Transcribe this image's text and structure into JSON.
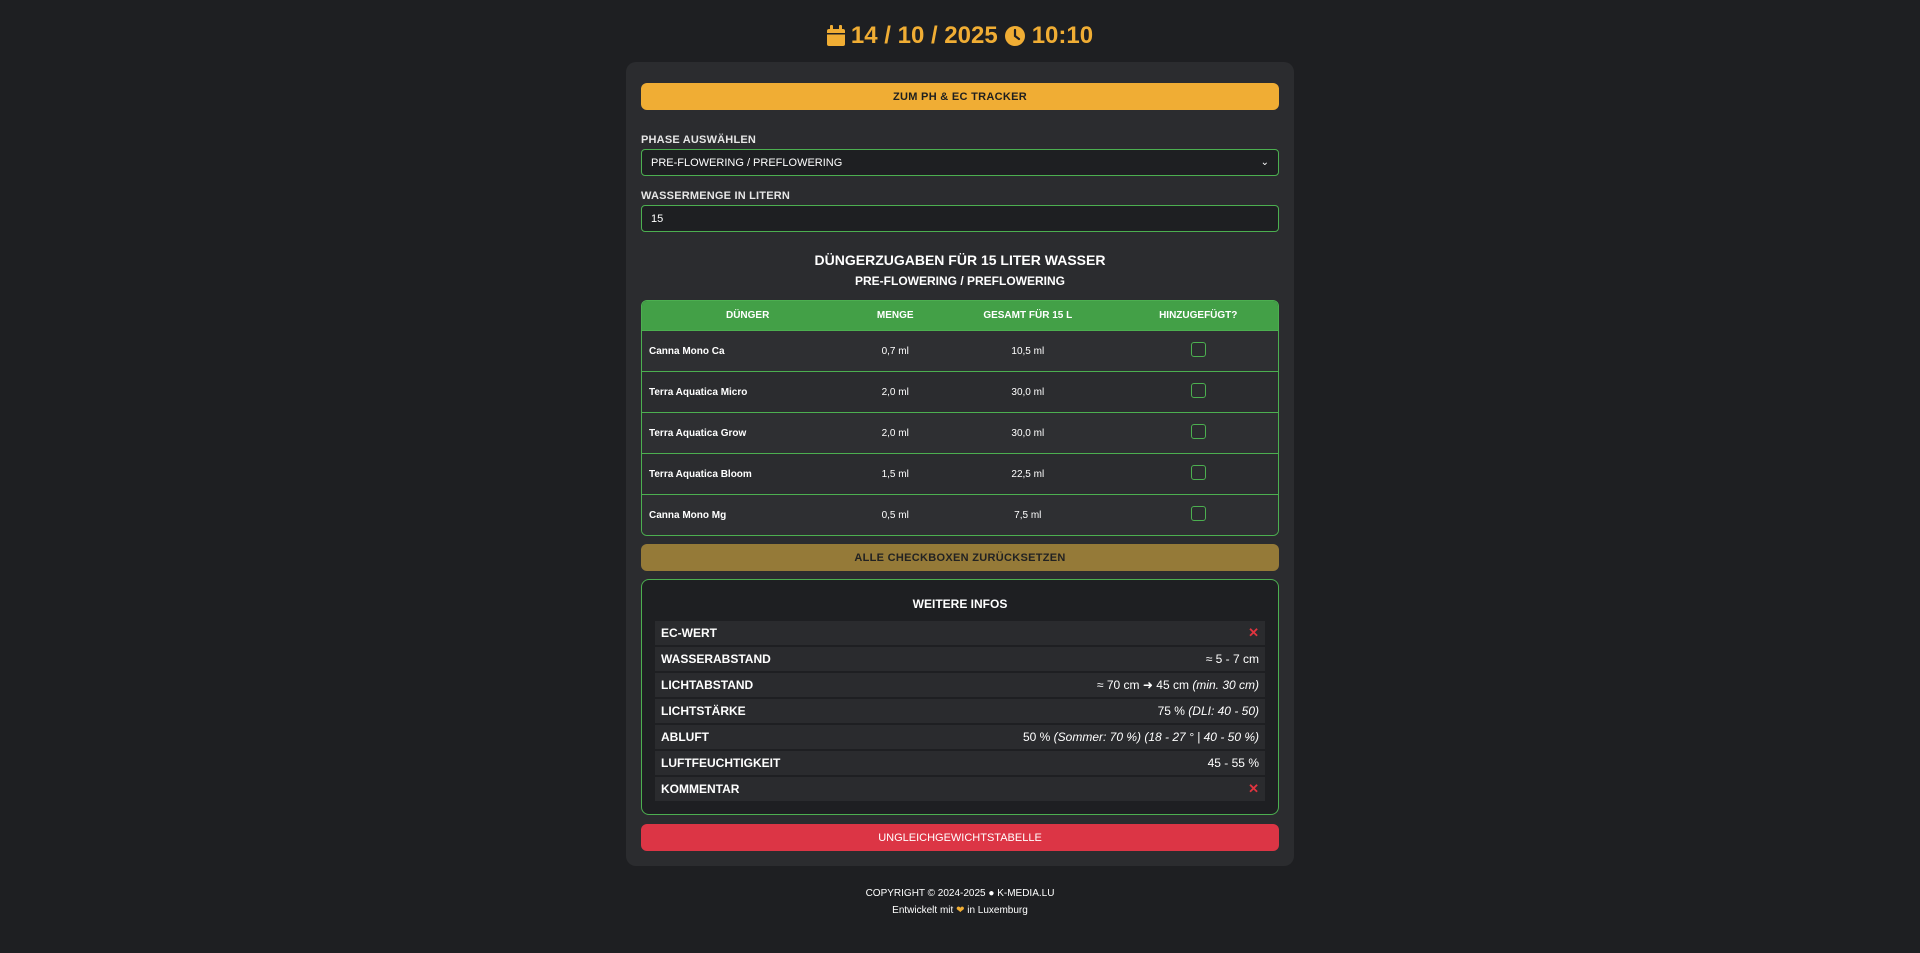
{
  "header": {
    "date": "14 / 10 / 2025",
    "time": "10:10",
    "date_icon": "calendar-icon",
    "time_icon": "clock-icon"
  },
  "tracker_button": "ZUM PH & EC TRACKER",
  "phase": {
    "label": "PHASE AUSWÄHLEN",
    "selected": "PRE-FLOWERING / PREFLOWERING"
  },
  "water": {
    "label": "WASSERMENGE IN LITERN",
    "value": "15"
  },
  "section": {
    "title": "DÜNGERZUGABEN FÜR 15 LITER WASSER",
    "subtitle": "PRE-FLOWERING / PREFLOWERING"
  },
  "table": {
    "headers": [
      "DÜNGER",
      "MENGE",
      "GESAMT FÜR 15 L",
      "HINZUGEFÜGT?"
    ],
    "rows": [
      {
        "name": "Canna Mono Ca",
        "amount": "0,7 ml",
        "total": "10,5 ml",
        "added": false
      },
      {
        "name": "Terra Aquatica Micro",
        "amount": "2,0 ml",
        "total": "30,0 ml",
        "added": false
      },
      {
        "name": "Terra Aquatica Grow",
        "amount": "2,0 ml",
        "total": "30,0 ml",
        "added": false
      },
      {
        "name": "Terra Aquatica Bloom",
        "amount": "1,5 ml",
        "total": "22,5 ml",
        "added": false
      },
      {
        "name": "Canna Mono Mg",
        "amount": "0,5 ml",
        "total": "7,5 ml",
        "added": false
      }
    ]
  },
  "reset_button": "ALLE CHECKBOXEN ZURÜCKSETZEN",
  "info": {
    "title": "WEITERE INFOS",
    "rows": [
      {
        "key": "EC-WERT",
        "value": "✕"
      },
      {
        "key": "WASSERABSTAND",
        "value": "≈ 5 - 7 cm"
      },
      {
        "key": "LICHTABSTAND",
        "value_a": "≈ 70 cm",
        "value_b": "45 cm",
        "note": "(min. 30 cm)"
      },
      {
        "key": "LICHTSTÄRKE",
        "value": "75 %",
        "note": "(DLI: 40 - 50)"
      },
      {
        "key": "ABLUFT",
        "value": "50 %",
        "note": "(Sommer: 70 %) (18 - 27 ° | 40 - 50 %)"
      },
      {
        "key": "LUFTFEUCHTIGKEIT",
        "value": "45 - 55 %"
      },
      {
        "key": "KOMMENTAR",
        "value": "✕"
      }
    ]
  },
  "imbalance_button": "UNGLEICHGEWICHTSTABELLE",
  "footer": {
    "copyright": "COPYRIGHT © 2024-2025 ● K-MEDIA.LU",
    "made_prefix": "Entwickelt mit",
    "made_suffix": "in Luxemburg",
    "heart_color": "#f0ad34"
  },
  "colors": {
    "accent": "#f0ad34",
    "green": "#4caf50",
    "danger": "#dc3545"
  }
}
